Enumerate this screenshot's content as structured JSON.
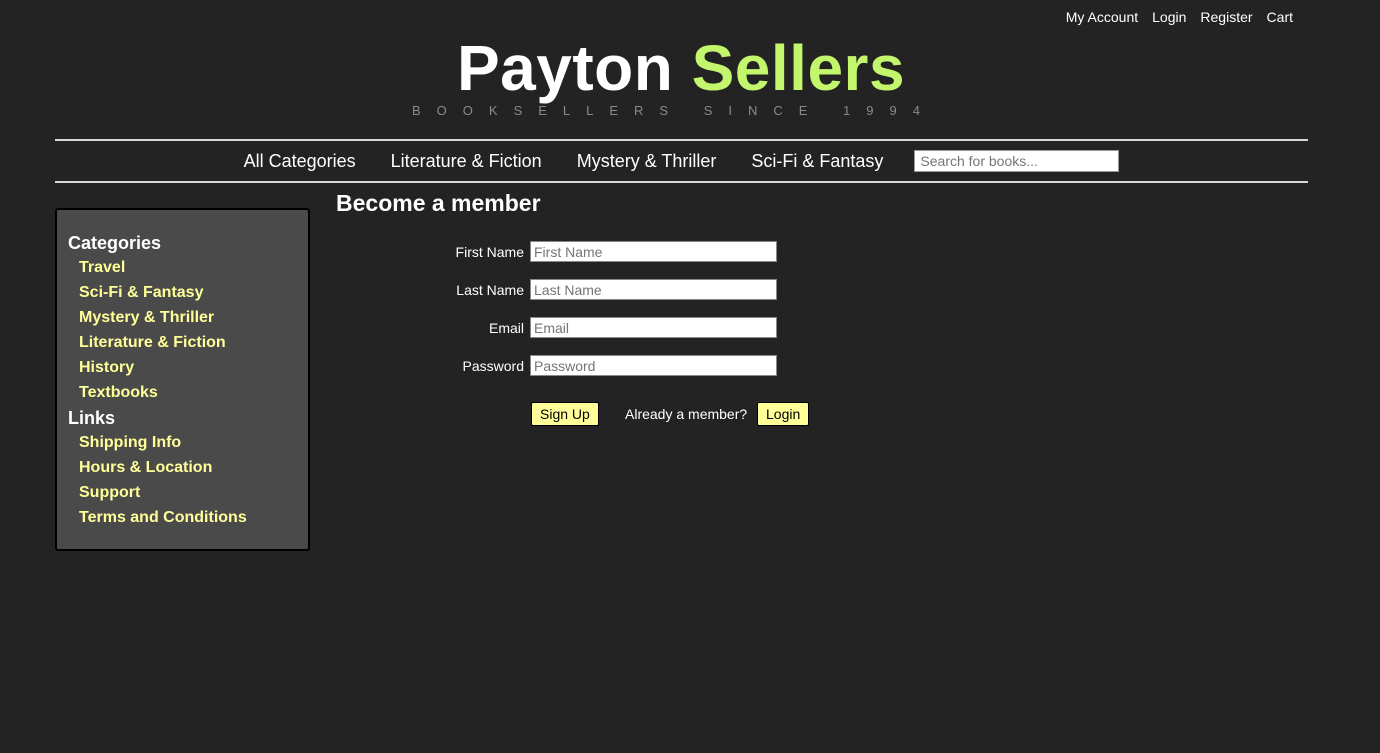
{
  "topnav": {
    "my_account": "My Account",
    "login": "Login",
    "register": "Register",
    "cart": "Cart"
  },
  "brand": {
    "name_part1": "Payton",
    "name_part2": "Sellers",
    "tagline": "BOOKSELLERS SINCE 1994",
    "accent_color": "#c3f56d"
  },
  "mainnav": {
    "items": [
      "All Categories",
      "Literature & Fiction",
      "Mystery & Thriller",
      "Sci-Fi & Fantasy"
    ],
    "search_placeholder": "Search for books..."
  },
  "sidebar": {
    "categories_title": "Categories",
    "categories": [
      "Travel",
      "Sci-Fi & Fantasy",
      "Mystery & Thriller",
      "Literature & Fiction",
      "History",
      "Textbooks"
    ],
    "links_title": "Links",
    "links": [
      "Shipping Info",
      "Hours & Location",
      "Support",
      "Terms and Conditions"
    ],
    "link_color": "#ffff99"
  },
  "form": {
    "heading": "Become a member",
    "fields": [
      {
        "label": "First Name",
        "placeholder": "First Name"
      },
      {
        "label": "Last Name",
        "placeholder": "Last Name"
      },
      {
        "label": "Email",
        "placeholder": "Email"
      },
      {
        "label": "Password",
        "placeholder": "Password"
      }
    ],
    "signup_label": "Sign Up",
    "already_member": "Already a member?",
    "login_label": "Login"
  }
}
